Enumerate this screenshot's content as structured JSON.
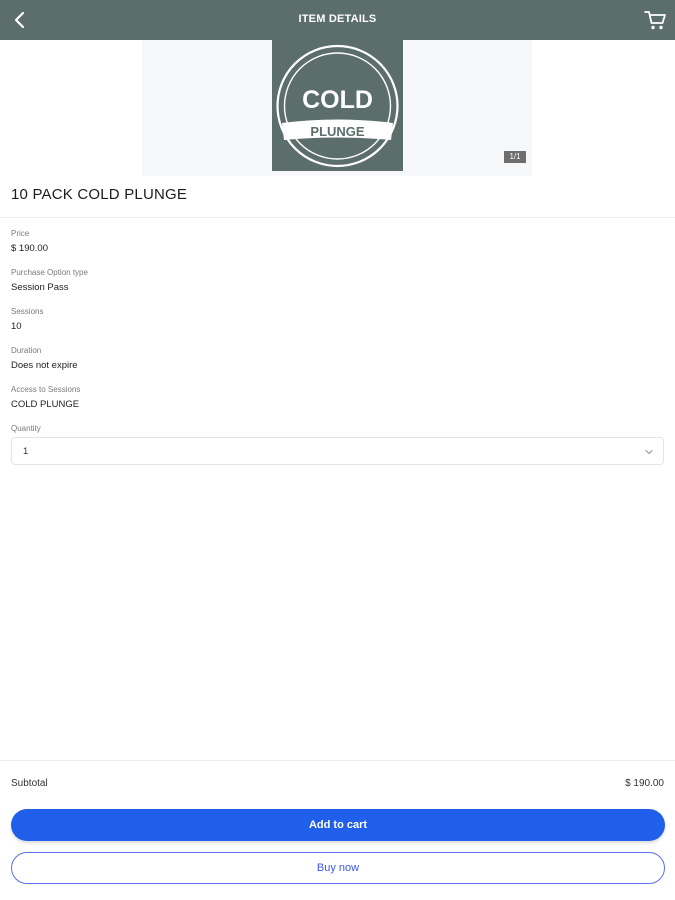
{
  "header": {
    "title": "ITEM DETAILS",
    "back_icon": "chevron-left-icon",
    "cart_icon": "shopping-cart-icon",
    "bg_color": "#5c6e6b"
  },
  "gallery": {
    "logo_top_text": "COLD",
    "logo_band_text": "PLUNGE",
    "counter": "1/1"
  },
  "product": {
    "title": "10 PACK COLD PLUNGE"
  },
  "details": [
    {
      "label": "Price",
      "value": "$ 190.00"
    },
    {
      "label": "Purchase Option type",
      "value": "Session Pass"
    },
    {
      "label": "Sessions",
      "value": "10"
    },
    {
      "label": "Duration",
      "value": "Does not expire"
    },
    {
      "label": "Access to Sessions",
      "value": "COLD PLUNGE"
    }
  ],
  "quantity": {
    "label": "Quantity",
    "value": "1",
    "chevron_icon": "chevron-down-icon"
  },
  "footer": {
    "subtotal_label": "Subtotal",
    "subtotal_value": "$ 190.00",
    "add_to_cart_label": "Add to cart",
    "buy_now_label": "Buy now",
    "accent_color": "#1f5fe9"
  }
}
